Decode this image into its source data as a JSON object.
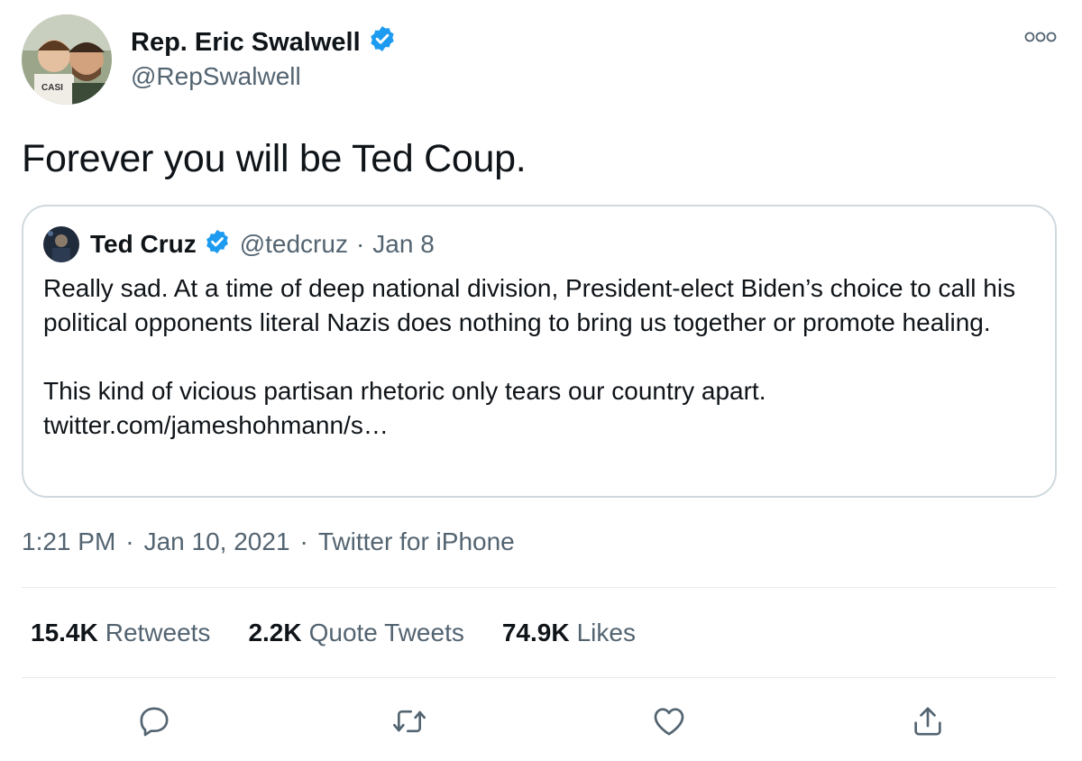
{
  "author": {
    "name": "Rep. Eric Swalwell",
    "handle": "@RepSwalwell",
    "verified": true
  },
  "tweet": {
    "text": "Forever you will be Ted Coup."
  },
  "quoted_tweet": {
    "name": "Ted Cruz",
    "handle": "@tedcruz",
    "separator": "·",
    "date": "Jan 8",
    "verified": true,
    "paragraph_1": "Really sad. At a time of deep national division, President-elect Biden’s choice to call his political opponents literal Nazis does nothing to bring us together or promote healing.",
    "paragraph_2": "This kind of vicious partisan rhetoric only tears our country apart.",
    "link": "twitter.com/jameshohmann/s…"
  },
  "meta": {
    "time": "1:21 PM",
    "separator": "·",
    "date": "Jan 10, 2021",
    "source": "Twitter for iPhone"
  },
  "stats": {
    "retweets_count": "15.4K",
    "retweets_label": "Retweets",
    "quotes_count": "2.2K",
    "quotes_label": "Quote Tweets",
    "likes_count": "74.9K",
    "likes_label": "Likes"
  },
  "icons": {
    "reply": "reply-icon",
    "retweet": "retweet-icon",
    "like": "heart-icon",
    "share": "share-icon",
    "more": "more-icon",
    "verified": "verified-badge-icon"
  },
  "colors": {
    "verified_blue": "#1d9bf0",
    "secondary_text": "#536471",
    "border": "#cfd9de"
  }
}
